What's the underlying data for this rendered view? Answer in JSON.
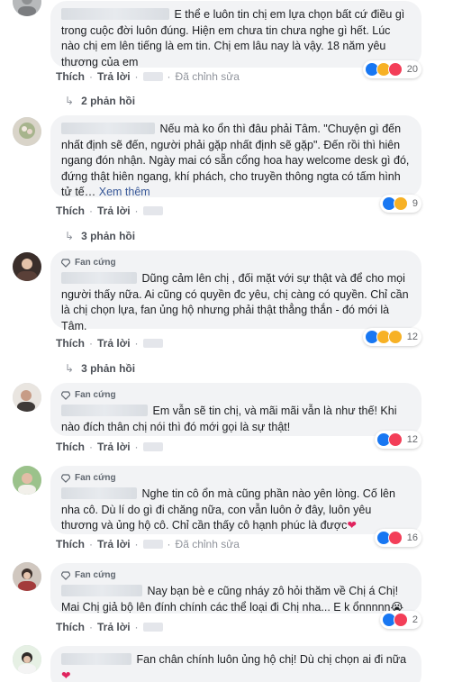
{
  "comments": [
    {
      "badge": "",
      "text": "E thể e luôn tin chị em lựa chọn bất cứ điều gì trong cuộc đời luôn đúng. Hiện em chưa tin chưa nghe gì hết. Lúc nào chị em lên tiếng là em tin. Chị em lâu nay là vậy. 18 năm yêu thương của em",
      "see_more": "",
      "reactions": [
        "like-icon",
        "haha-icon",
        "love-icon"
      ],
      "reaction_count": "20",
      "like_label": "Thích",
      "reply_label": "Trả lời",
      "edited_label": "Đã chỉnh sửa",
      "replies_label": "2 phản hồi"
    },
    {
      "badge": "",
      "text": "Nếu mà ko ổn thì đâu phải Tâm. \"Chuyện gì đến nhất định sẽ đến, người phải gặp nhất định sẽ gặp\". Đến rồi thì hiên ngang đón nhận. Ngày mai có sẵn cổng hoa hay welcome desk gì đó, đứng thật hiên ngang, khí phách, cho truyền thông ngta có tấm hình tử tế…",
      "see_more": "Xem thêm",
      "reactions": [
        "like-icon",
        "wow-icon"
      ],
      "reaction_count": "9",
      "like_label": "Thích",
      "reply_label": "Trả lời",
      "edited_label": "",
      "replies_label": "3 phản hồi"
    },
    {
      "badge": "Fan cứng",
      "text": "Dũng cảm lên chị , đối mặt với sự thật và để cho mọi người thấy nữa. Ai cũng có quyền đc yêu, chị càng có quyền. Chỉ cần là chị chọn lựa, fan ủng hộ nhưng phải thật thẳng thắn - đó mới là Tâm.",
      "see_more": "",
      "reactions": [
        "like-icon",
        "haha-icon",
        "wow-icon"
      ],
      "reaction_count": "12",
      "like_label": "Thích",
      "reply_label": "Trả lời",
      "edited_label": "",
      "replies_label": "3 phản hồi"
    },
    {
      "badge": "Fan cứng",
      "text": "Em vẫn sẽ tin chị, và mãi mãi vẫn là như thế! Khi nào đích thân chị nói thì đó mới gọi là sự thật!",
      "see_more": "",
      "reactions": [
        "like-icon",
        "love-icon"
      ],
      "reaction_count": "12",
      "like_label": "Thích",
      "reply_label": "Trả lời",
      "edited_label": "",
      "replies_label": ""
    },
    {
      "badge": "Fan cứng",
      "text": "Nghe tin cô ổn mà cũng phần nào yên lòng. Cố lên nha cô. Dù lí do gì đi chăng nữa, con vẫn luôn ở đây, luôn yêu thương và ủng hộ cô. Chỉ cần thấy cô hạnh phúc là được",
      "see_more": "",
      "heart": "❤",
      "reactions": [
        "like-icon",
        "love-icon"
      ],
      "reaction_count": "16",
      "like_label": "Thích",
      "reply_label": "Trả lời",
      "edited_label": "Đã chỉnh sửa",
      "replies_label": ""
    },
    {
      "badge": "Fan cứng",
      "text": "Nay bạn bè e cũng nháy zô hỏi thăm về Chị á Chị! Mai Chị giả bộ lên đính chính các thể loại đi Chị nha... E k ổnnnnn",
      "see_more": "",
      "emoji": "😭",
      "reactions": [
        "like-icon",
        "love-icon"
      ],
      "reaction_count": "2",
      "like_label": "Thích",
      "reply_label": "Trả lời",
      "edited_label": "",
      "replies_label": ""
    },
    {
      "badge": "",
      "text": "Fan chân chính luôn ủng hộ chị! Dù chị chọn ai đi nữa",
      "see_more": "",
      "heart": "❤",
      "reactions": [],
      "reaction_count": "",
      "like_label": "",
      "reply_label": "",
      "edited_label": "",
      "replies_label": ""
    }
  ],
  "colors": {
    "like": "#1877f2",
    "love": "#f33e58",
    "haha": "#f7b125",
    "wow": "#f7b125",
    "link": "#385898",
    "bubble": "#f2f3f5"
  }
}
